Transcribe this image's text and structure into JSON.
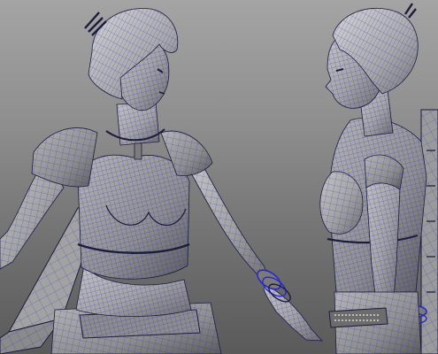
{
  "viewport": {
    "background_top": "#a4a4a4",
    "background_bottom": "#5a5a5a",
    "mesh_fill": "#a9a9a9",
    "mesh_shade": "#6f6f6f",
    "wire_color": "#2a27c9",
    "wire_dark": "#1c1c3c"
  },
  "models": [
    {
      "view": "front-three-quarter"
    },
    {
      "view": "side-profile"
    }
  ]
}
